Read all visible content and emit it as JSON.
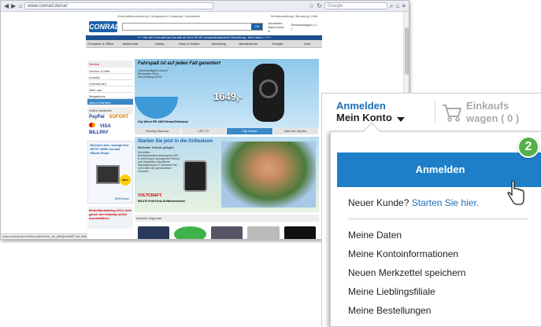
{
  "browser": {
    "url": "www.conrad.de/ce/",
    "search_placeholder": "Google",
    "back_icon": "back-arrow-icon",
    "forward_icon": "forward-arrow-icon"
  },
  "site": {
    "logo": "CONRAD",
    "toplinks_left": "Geschäftskundenshop | Megastores | Kataloge | Newsletter",
    "toplinks_right": "Direktbestellung | Beratung | Hilfe",
    "mini_account_1": "Anmelden",
    "mini_account_2": "Mein Konto ▾",
    "mini_cart": "Einkaufswagen ( 0 )",
    "promo": "+++ Bei der ConradCard bereits ab Euro 50,00 versandkostenfreie Bestellung. Jetzt Infos »  +++",
    "nav": [
      "Computer & Office",
      "Multimedia",
      "Hobby",
      "Haus & Garten",
      "Werkzeug",
      "Bauelemente",
      "Energie",
      "Auto"
    ],
    "left_head": "Service",
    "left_items": [
      "Service & Hilfe",
      "Kontakt",
      "ConradCard",
      "Über uns",
      "Megastores",
      "Jobs & Karriere"
    ],
    "online_bezahlen": "Online bezahlen",
    "payments": [
      "PayPal",
      "SOFORT",
      "Mastercard",
      "VISA",
      "BILLPAY"
    ],
    "ebook_text": "Gleichen den -wenige Ihre JETZT HIER Conrad eBook-Shop!",
    "ebook_badge": "NEU!",
    "ebook_link": "BMKMaas",
    "katalog_text": "Modellbaukatalog 2014 Jetzt gleich den Katalog online durchblättern",
    "hero_title": "Fahrspaß ist auf jeden Fall garantiert",
    "hero_sub": "Geschwindigkeit 16km/h Reichweite 40km Nennleistung 500W",
    "hero_price": "1649,-",
    "hero_caption": "City Wheel IPS 1500 Einrad-Elektrorad",
    "tabs": [
      "Monkey Banana",
      "LED TV",
      "City Wheel",
      "Idee der Woche"
    ],
    "active_tab": 2,
    "grill_title": "Starten Sie jetzt in die Grillsaison",
    "grill_sub": "Mit bester Technik gelingt's",
    "grill_desc": "Schnelles Kerntemperaturmessung bis 300 in Gellmung 4 anzeigende Fleisch- und Garkanten Akustische Signalgebung in 5 Sprachen bei erreichten der gewünschten Garstufe",
    "grill_brand": "VOLTCRAFT.",
    "grill_caption": "MS-670 Profi Funk-Grillthermometer",
    "aktuell": "Aktuelle Angebote",
    "status": "www.conrad.de/ce/de/content/mrs_av_jobs/jobs/MIT-art-stell_jobs"
  },
  "zoom": {
    "anmelden_label": "Anmelden",
    "mein_konto_label": "Mein Konto",
    "cart_line1": "Einkaufs",
    "cart_line2": "wagen ( 0 )",
    "login_button": "Anmelden",
    "step_badge": "2",
    "new_customer": "Neuer Kunde?",
    "new_customer_link": "Starten Sie hier.",
    "menu": [
      "Meine Daten",
      "Meine Kontoinformationen",
      "Neuen Merkzettel speichern",
      "Meine Lieblingsfiliale",
      "Meine Bestellungen"
    ]
  },
  "colors": {
    "brand_blue": "#1e7fc8",
    "step_green": "#54b14a",
    "link_blue": "#1f6eb8"
  }
}
